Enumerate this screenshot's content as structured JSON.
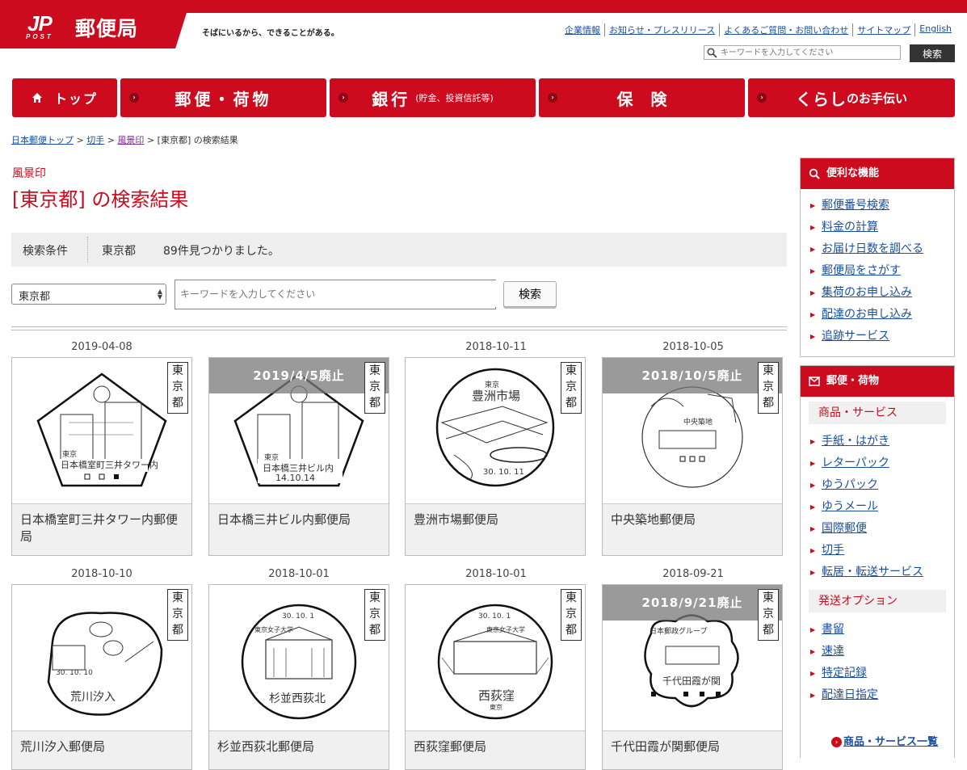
{
  "header": {
    "logo_mark": "JP",
    "logo_post": "POST",
    "logo_text": "郵便局",
    "tagline": "そばにいるから、できることがある。",
    "utility_links": [
      "企業情報",
      "お知らせ・プレスリリース",
      "よくあるご質問・お問い合わせ",
      "サイトマップ",
      "English"
    ],
    "search_placeholder": "キーワードを入力してください",
    "search_button": "検索"
  },
  "nav": {
    "top": "トップ",
    "mail": "郵便・荷物",
    "bank": "銀行",
    "bank_sub": "(貯金、投資信託等)",
    "insurance": "保険",
    "life": "くらし",
    "life_sub": "のお手伝い"
  },
  "breadcrumb": {
    "home": "日本郵便トップ",
    "stamps": "切手",
    "scenic": "風景印",
    "current": "[東京都] の検索結果",
    "separator": ">"
  },
  "main": {
    "category": "風景印",
    "title": "[東京都] の検索結果",
    "condition_label": "検索条件",
    "condition_value": "東京都",
    "result_count": "89件見つかりました。",
    "select_value": "東京都",
    "keyword_placeholder": "キーワードを入力してください",
    "search_button": "検索"
  },
  "cards": [
    {
      "date": "2019-04-08",
      "name": "日本橋室町三井タワー内郵便局",
      "pref": "東京都",
      "banner": "",
      "stamp_text": "日本橋室町三井タワー内",
      "stamp_top": "東京"
    },
    {
      "date": "",
      "name": "日本橋三井ビル内郵便局",
      "pref": "東京都",
      "banner": "2019/4/5廃止",
      "stamp_text": "日本橋三井ビル内",
      "stamp_top": "東京",
      "stamp_date": "14.10.14"
    },
    {
      "date": "2018-10-11",
      "name": "豊洲市場郵便局",
      "pref": "東京都",
      "banner": "",
      "stamp_text": "豊洲市場",
      "stamp_top": "東京",
      "stamp_date": "30. 10. 11"
    },
    {
      "date": "2018-10-05",
      "name": "中央築地郵便局",
      "pref": "東京都",
      "banner": "2018/10/5廃止",
      "stamp_text": "中央築地",
      "stamp_top": ""
    },
    {
      "date": "2018-10-10",
      "name": "荒川汐入郵便局",
      "pref": "東京都",
      "banner": "",
      "stamp_text": "荒川汐入",
      "stamp_top": "",
      "stamp_date": "30. 10. 10"
    },
    {
      "date": "2018-10-01",
      "name": "杉並西荻北郵便局",
      "pref": "東京都",
      "banner": "",
      "stamp_text": "杉並西荻北",
      "stamp_top": "東京女子大学",
      "stamp_date": "30. 10. 1"
    },
    {
      "date": "2018-10-01",
      "name": "西荻窪郵便局",
      "pref": "東京都",
      "banner": "",
      "stamp_text": "西荻窪",
      "stamp_top": "東京女子大学",
      "stamp_date": "30. 10. 1",
      "stamp_bottom": "東京"
    },
    {
      "date": "2018-09-21",
      "name": "千代田霞が関郵便局",
      "pref": "東京都",
      "banner": "2018/9/21廃止",
      "stamp_text": "千代田霞が関",
      "stamp_top": "日本郵政グループ"
    }
  ],
  "sidebar": {
    "useful_title": "便利な機能",
    "useful_items": [
      "郵便番号検索",
      "料金の計算",
      "お届け日数を調べる",
      "郵便局をさがす",
      "集荷のお申し込み",
      "配達のお申し込み",
      "追跡サービス"
    ],
    "mail_title": "郵便・荷物",
    "products_heading": "商品・サービス",
    "products_items": [
      "手紙・はがき",
      "レターパック",
      "ゆうパック",
      "ゆうメール",
      "国際郵便",
      "切手",
      "転居・転送サービス"
    ],
    "options_heading": "発送オプション",
    "options_items": [
      "書留",
      "速達",
      "特定記録",
      "配達日指定"
    ],
    "more_link": "商品・サービス一覧"
  },
  "colors": {
    "brand_red": "#cc0b1e",
    "link_blue": "#1a4fa0"
  }
}
